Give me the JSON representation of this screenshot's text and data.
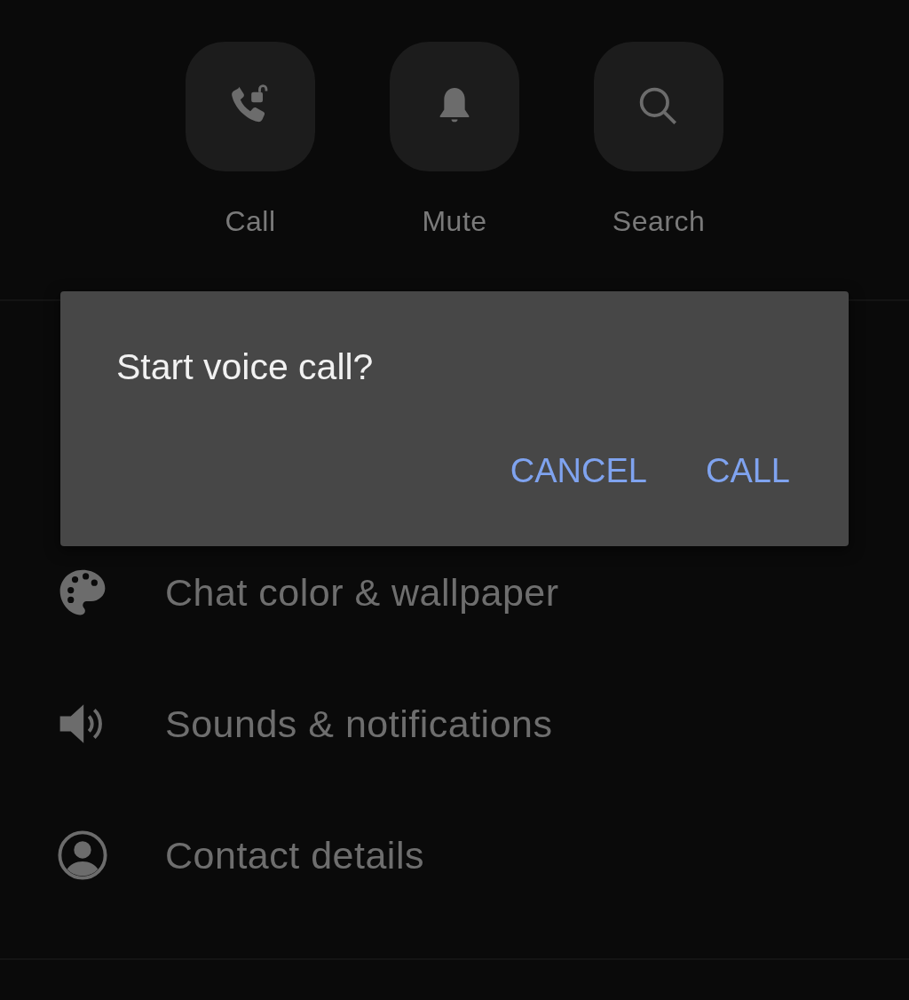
{
  "actions": [
    {
      "kind": "call",
      "label": "Call"
    },
    {
      "kind": "mute",
      "label": "Mute"
    },
    {
      "kind": "search",
      "label": "Search"
    }
  ],
  "menu": [
    {
      "kind": "palette",
      "label": "Chat color & wallpaper"
    },
    {
      "kind": "sound",
      "label": "Sounds & notifications"
    },
    {
      "kind": "contact",
      "label": "Contact details"
    }
  ],
  "dialog": {
    "title": "Start voice call?",
    "buttons": [
      "CANCEL",
      "CALL"
    ]
  }
}
